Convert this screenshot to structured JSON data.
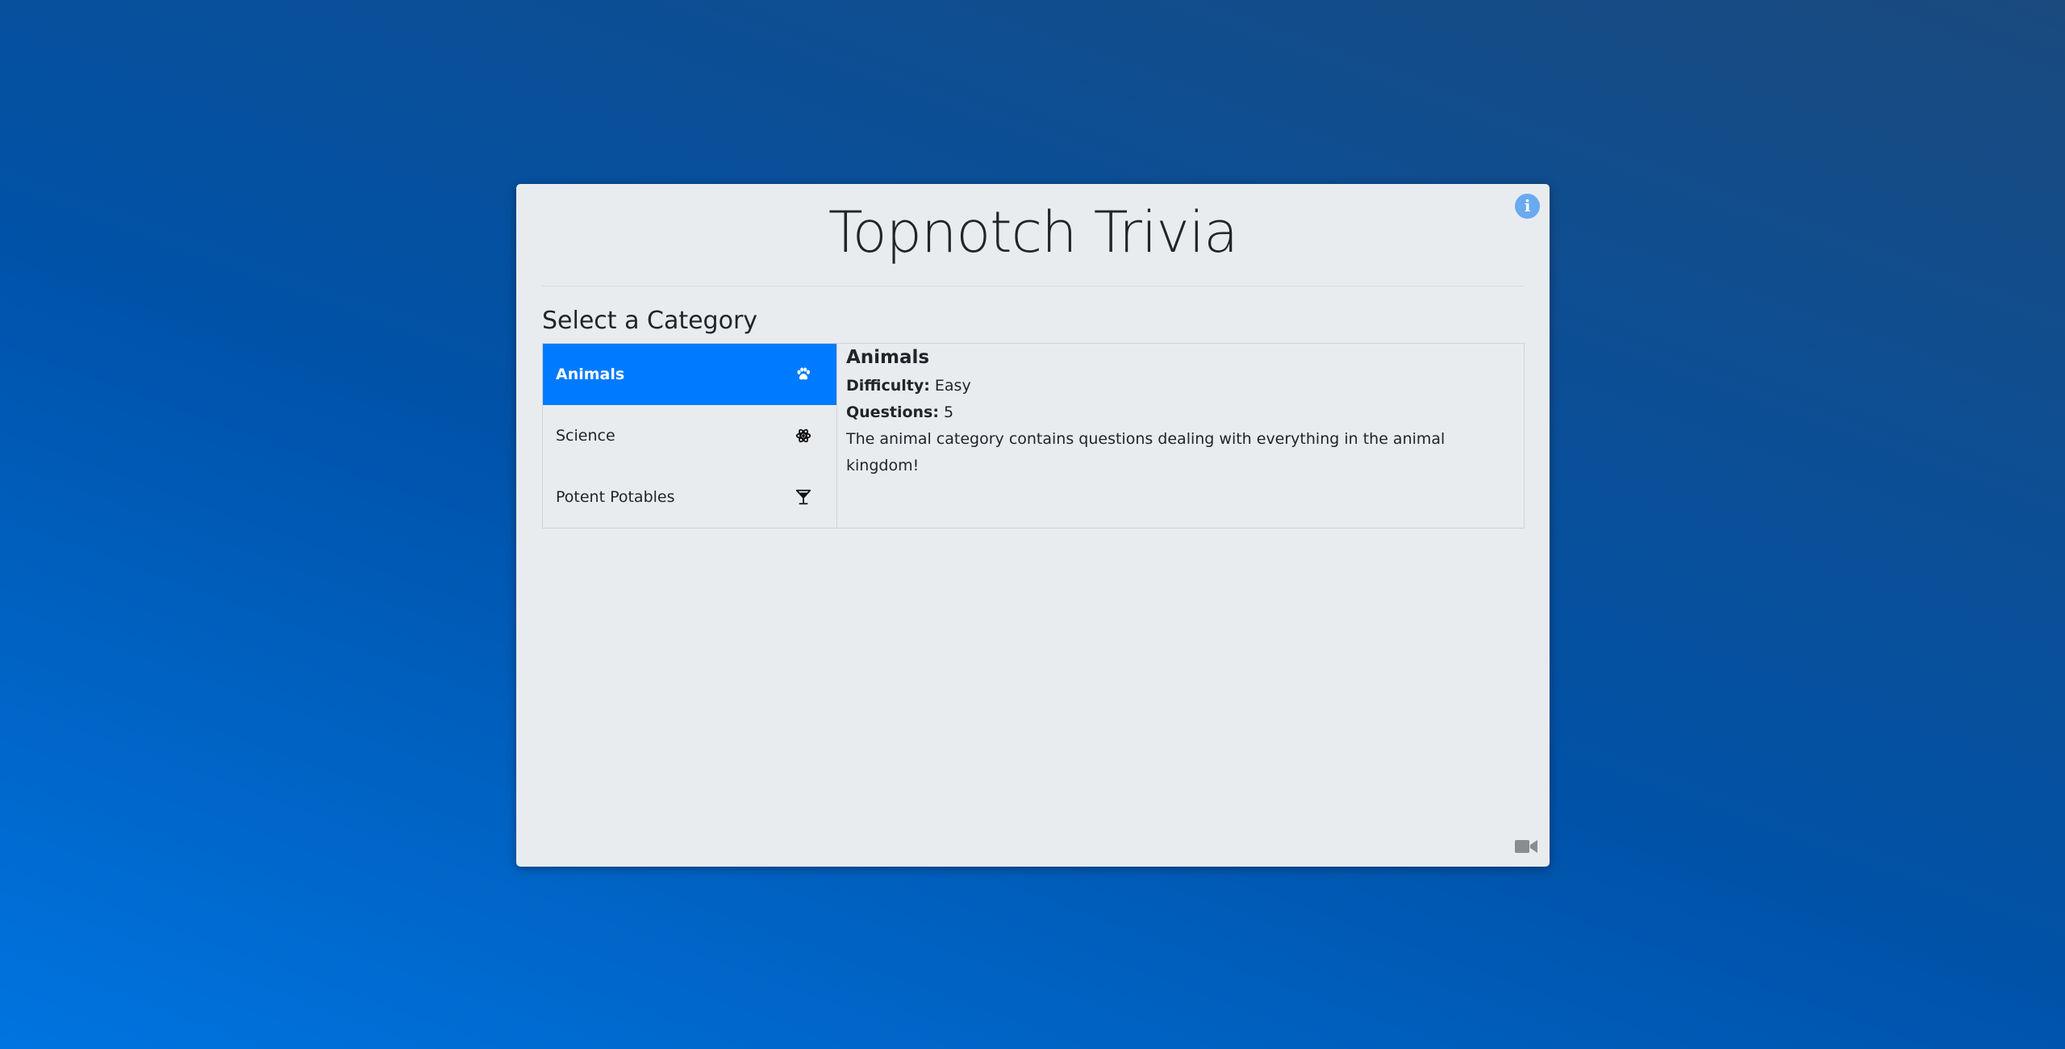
{
  "app": {
    "title": "Topnotch Trivia"
  },
  "section": {
    "heading": "Select a Category"
  },
  "categories": [
    {
      "label": "Animals",
      "icon": "paw-icon",
      "active": true
    },
    {
      "label": "Science",
      "icon": "atom-icon",
      "active": false
    },
    {
      "label": "Potent Potables",
      "icon": "cocktail-glass-icon",
      "active": false
    }
  ],
  "selected": {
    "name": "Animals",
    "difficulty_label": "Difficulty:",
    "difficulty_value": "Easy",
    "questions_label": "Questions:",
    "questions_value": "5",
    "description": "The animal category contains questions dealing with everything in the animal kingdom!"
  },
  "colors": {
    "accent": "#007bff",
    "card_bg": "#e9ecef",
    "info_button": "#6aaaf0"
  },
  "icons": {
    "info": "info-icon",
    "camera": "video-camera-icon"
  }
}
